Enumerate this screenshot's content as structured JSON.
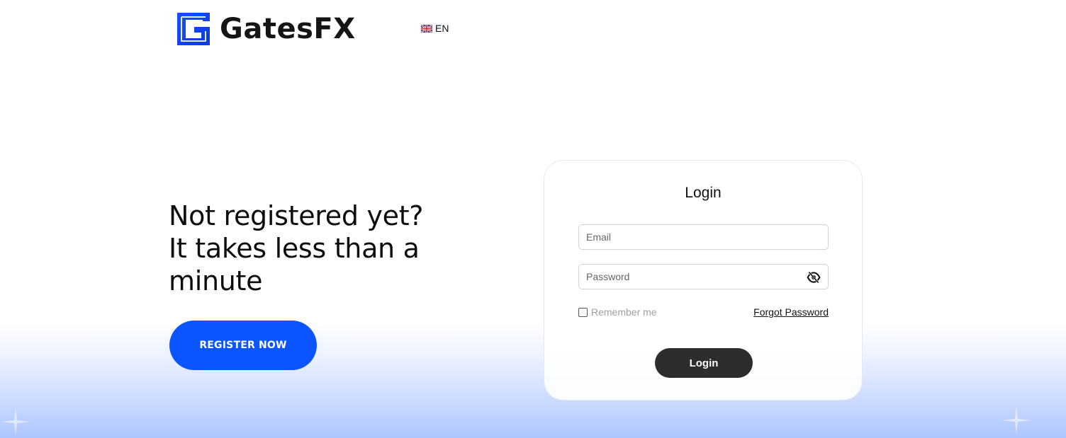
{
  "brand": {
    "name": "GatesFX",
    "logo_icon": "gatesfx-logo-icon",
    "accent_color": "#0a55ff"
  },
  "language": {
    "code": "EN",
    "flag_icon": "uk-flag-icon"
  },
  "hero": {
    "title_line1": "Not registered yet?",
    "title_line2": "It takes less than a",
    "title_line3": "minute",
    "register_label": "REGISTER NOW"
  },
  "login_form": {
    "title": "Login",
    "email_placeholder": "Email",
    "email_value": "",
    "password_placeholder": "Password",
    "password_value": "",
    "password_toggle_icon": "eye-slash-icon",
    "remember_label": "Remember me",
    "remember_checked": false,
    "forgot_label": "Forgot Password",
    "submit_label": "Login",
    "submit_color": "#2d2d2d"
  }
}
